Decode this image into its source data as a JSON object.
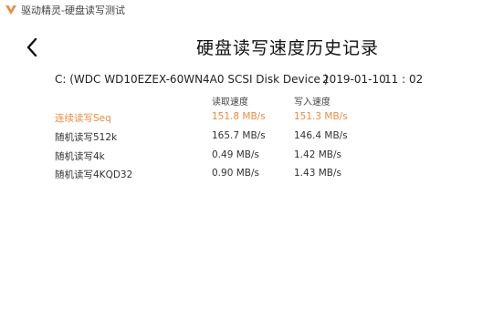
{
  "window": {
    "app_title": "驱动精灵-硬盘读写测试",
    "accent_color": "#f08a3c"
  },
  "header": {
    "back_icon": "chevron-left-icon",
    "title": "硬盘读写速度历史记录"
  },
  "disk": {
    "name": "C:  (WDC WD10EZEX-60WN4A0 SCSI Disk Device )",
    "date": "2019-01-10",
    "time": "11 : 02"
  },
  "table": {
    "headers": {
      "read": "读取速度",
      "write": "写入速度"
    },
    "rows": [
      {
        "name": "连续读写Seq",
        "read": "151.8 MB/s",
        "write": "151.3 MB/s",
        "highlight": true
      },
      {
        "name": "随机读写512k",
        "read": "165.7 MB/s",
        "write": "146.4 MB/s",
        "highlight": false
      },
      {
        "name": "随机读写4k",
        "read": "0.49 MB/s",
        "write": "1.42 MB/s",
        "highlight": false
      },
      {
        "name": "随机读写4KQD32",
        "read": "0.90 MB/s",
        "write": "1.43 MB/s",
        "highlight": false
      }
    ]
  }
}
